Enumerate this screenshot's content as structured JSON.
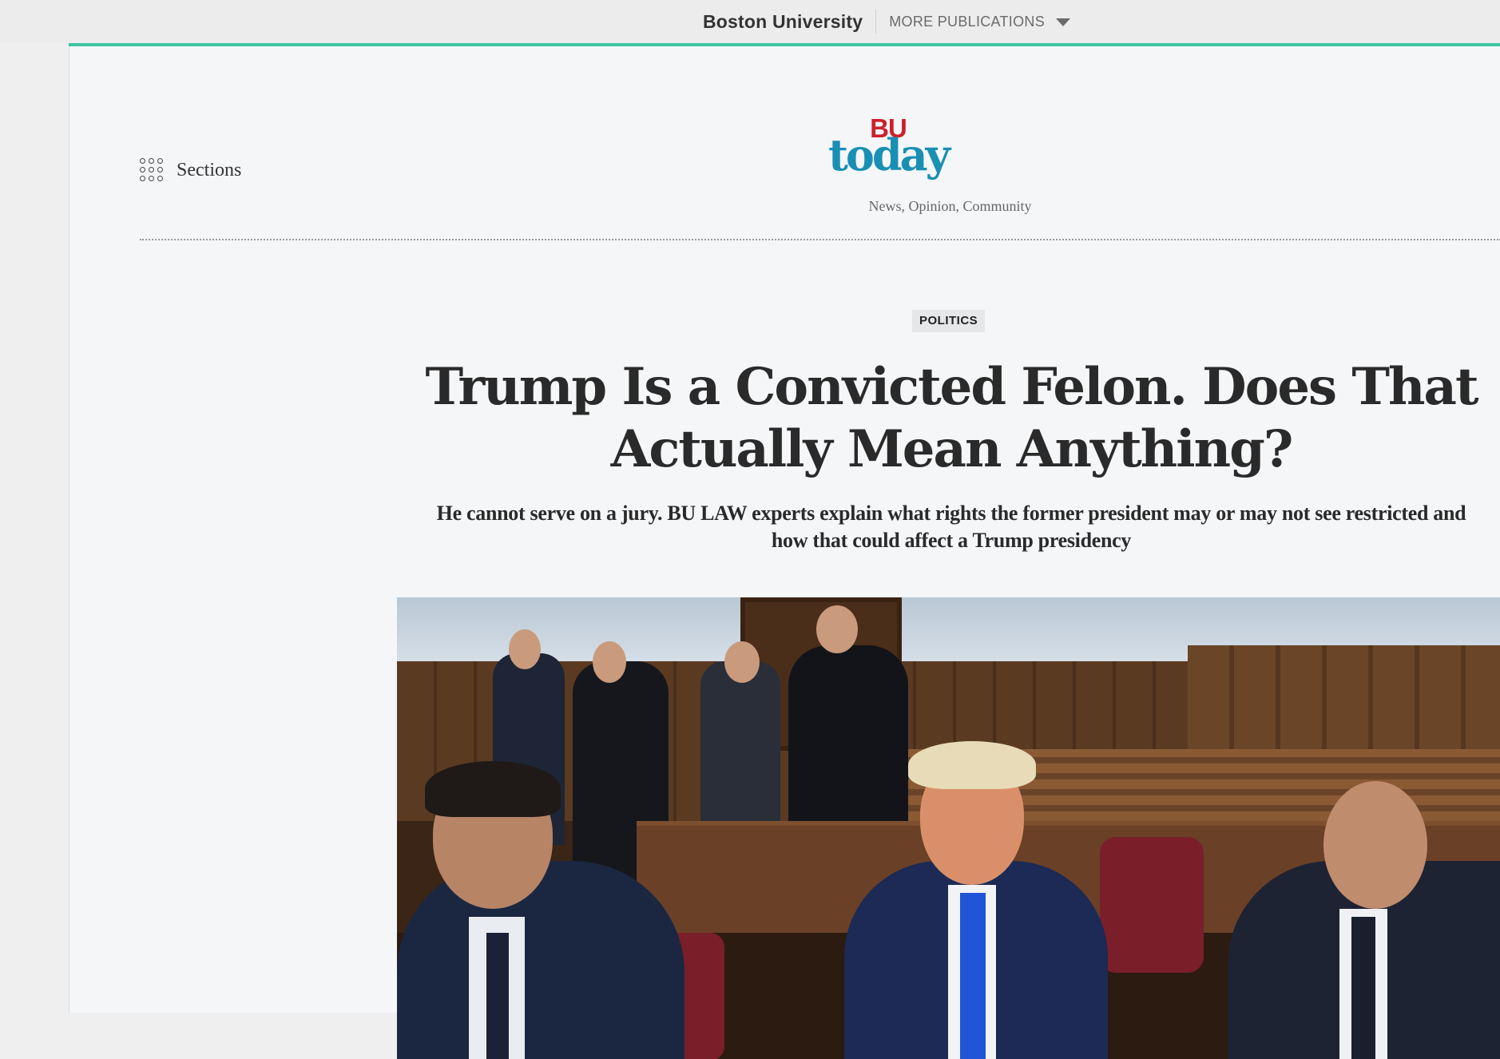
{
  "topbar": {
    "university": "Boston University",
    "more_publications": "MORE PUBLICATIONS"
  },
  "header": {
    "sections_label": "Sections",
    "logo_top": "BU",
    "logo_bottom": "today",
    "tagline": "News, Opinion, Community"
  },
  "article": {
    "category": "POLITICS",
    "headline": "Trump Is a Convicted Felon. Does That Actually Mean Anything?",
    "dek": "He cannot serve on a jury. BU LAW experts explain what rights the former president may or may not see restricted and how that could affect a Trump presidency"
  },
  "colors": {
    "accent_line": "#3cc6a1",
    "logo_bu": "#cc1f2d",
    "logo_today": "#1a8fb4"
  },
  "icons": {
    "sections": "grid-dots-icon",
    "more_publications": "caret-down-icon"
  }
}
